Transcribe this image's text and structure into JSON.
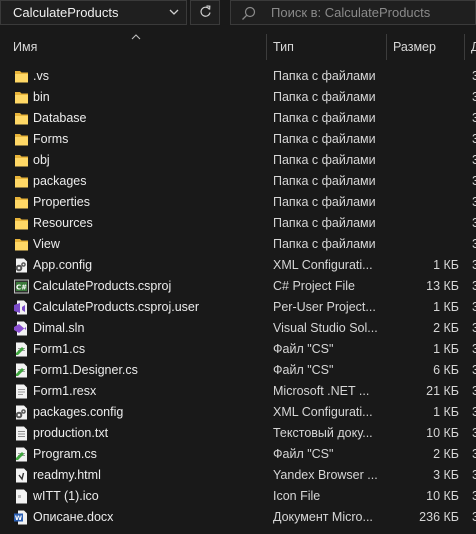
{
  "address_bar": {
    "path": "CalculateProducts"
  },
  "search": {
    "placeholder": "Поиск в: CalculateProducts"
  },
  "columns": {
    "name": "Имя",
    "type": "Тип",
    "size": "Размер",
    "extra": "Д"
  },
  "files": [
    {
      "name": ".vs",
      "type": "Папка с файлами",
      "size": "",
      "extra": "3",
      "icon": "folder-icon"
    },
    {
      "name": "bin",
      "type": "Папка с файлами",
      "size": "",
      "extra": "3",
      "icon": "folder-icon"
    },
    {
      "name": "Database",
      "type": "Папка с файлами",
      "size": "",
      "extra": "3",
      "icon": "folder-icon"
    },
    {
      "name": "Forms",
      "type": "Папка с файлами",
      "size": "",
      "extra": "3",
      "icon": "folder-icon"
    },
    {
      "name": "obj",
      "type": "Папка с файлами",
      "size": "",
      "extra": "3",
      "icon": "folder-icon"
    },
    {
      "name": "packages",
      "type": "Папка с файлами",
      "size": "",
      "extra": "3",
      "icon": "folder-icon"
    },
    {
      "name": "Properties",
      "type": "Папка с файлами",
      "size": "",
      "extra": "3",
      "icon": "folder-icon"
    },
    {
      "name": "Resources",
      "type": "Папка с файлами",
      "size": "",
      "extra": "3",
      "icon": "folder-icon"
    },
    {
      "name": "View",
      "type": "Папка с файлами",
      "size": "",
      "extra": "3",
      "icon": "folder-icon"
    },
    {
      "name": "App.config",
      "type": "XML Configurati...",
      "size": "1 КБ",
      "extra": "3",
      "icon": "config-file-icon"
    },
    {
      "name": "CalculateProducts.csproj",
      "type": "C# Project File",
      "size": "13 КБ",
      "extra": "3",
      "icon": "csproj-file-icon"
    },
    {
      "name": "CalculateProducts.csproj.user",
      "type": "Per-User Project...",
      "size": "1 КБ",
      "extra": "3",
      "icon": "csproj-user-file-icon"
    },
    {
      "name": "Dimal.sln",
      "type": "Visual Studio Sol...",
      "size": "2 КБ",
      "extra": "3",
      "icon": "sln-file-icon"
    },
    {
      "name": "Form1.cs",
      "type": "Файл \"CS\"",
      "size": "1 КБ",
      "extra": "3",
      "icon": "cs-file-icon"
    },
    {
      "name": "Form1.Designer.cs",
      "type": "Файл \"CS\"",
      "size": "6 КБ",
      "extra": "3",
      "icon": "cs-file-icon"
    },
    {
      "name": "Form1.resx",
      "type": "Microsoft .NET ...",
      "size": "21 КБ",
      "extra": "3",
      "icon": "resx-file-icon"
    },
    {
      "name": "packages.config",
      "type": "XML Configurati...",
      "size": "1 КБ",
      "extra": "3",
      "icon": "config-file-icon"
    },
    {
      "name": "production.txt",
      "type": "Текстовый доку...",
      "size": "10 КБ",
      "extra": "3",
      "icon": "text-file-icon"
    },
    {
      "name": "Program.cs",
      "type": "Файл \"CS\"",
      "size": "2 КБ",
      "extra": "3",
      "icon": "cs-file-icon"
    },
    {
      "name": "readmy.html",
      "type": "Yandex Browser ...",
      "size": "3 КБ",
      "extra": "3",
      "icon": "html-file-icon"
    },
    {
      "name": "wITT (1).ico",
      "type": "Icon File",
      "size": "10 КБ",
      "extra": "3",
      "icon": "ico-file-icon"
    },
    {
      "name": "Описане.docx",
      "type": "Документ Micro...",
      "size": "236 КБ",
      "extra": "3",
      "icon": "docx-file-icon"
    }
  ]
}
